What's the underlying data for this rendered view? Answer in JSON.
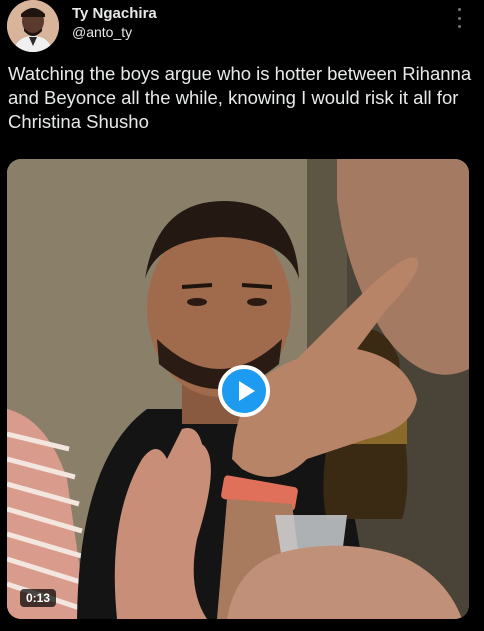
{
  "author": {
    "name": "Ty Ngachira",
    "handle": "@anto_ty"
  },
  "tweet": {
    "text": "Watching the boys argue who is hotter between Rihanna and Beyonce all the while, knowing I would risk it all for Christina Shusho"
  },
  "video": {
    "duration": "0:13"
  },
  "colors": {
    "background": "#000000",
    "text": "#e7e9ea",
    "accent": "#1d9bf0",
    "muted": "#71767b"
  },
  "icons": [
    "more-options-icon",
    "play-icon"
  ]
}
